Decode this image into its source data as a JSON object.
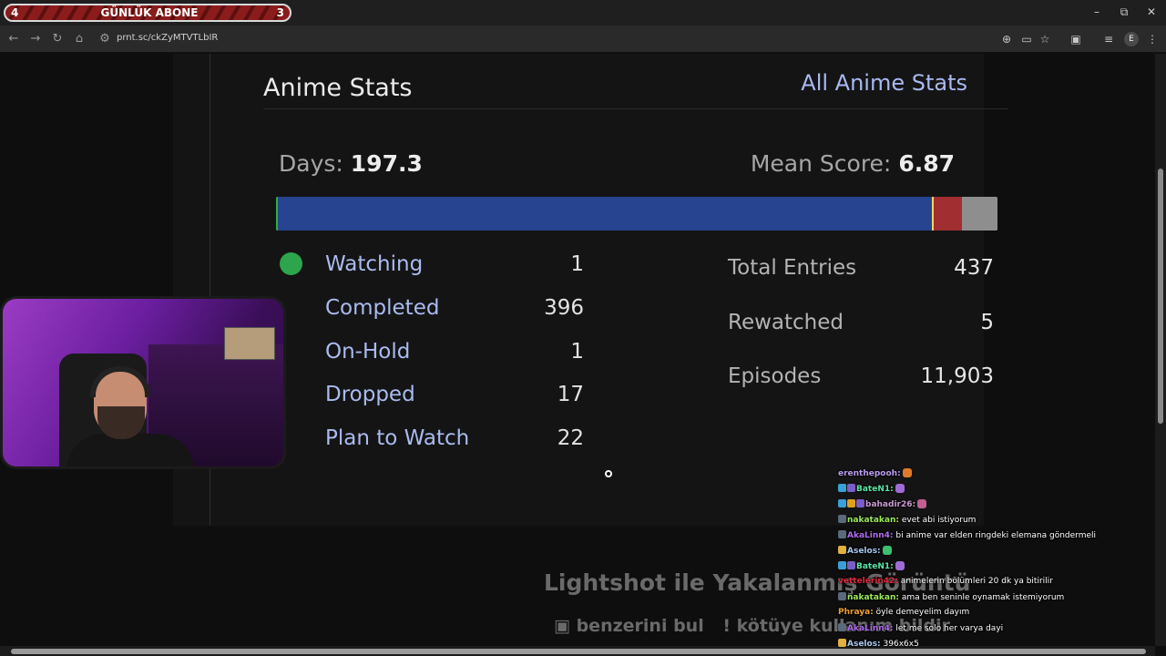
{
  "window": {
    "sub_banner": {
      "left": "4",
      "title": "GÜNLÜK ABONE",
      "right": "3"
    },
    "controls": {
      "minimize": "–",
      "restore": "⧉",
      "close": "✕"
    }
  },
  "browser": {
    "url": "prnt.sc/ckZyMTVTLbIR",
    "profile_initial": "E"
  },
  "stats": {
    "title": "Anime Stats",
    "all_link": "All Anime Stats",
    "days_label": "Days:",
    "days_value": "197.3",
    "mean_label": "Mean Score:",
    "mean_value": "6.87",
    "distribution": [
      {
        "status": "Watching",
        "count": 1,
        "color": "#2db039"
      },
      {
        "status": "Completed",
        "count": 396,
        "color": "#26448f"
      },
      {
        "status": "On-Hold",
        "count": 1,
        "color": "#f9d457"
      },
      {
        "status": "Dropped",
        "count": 17,
        "color": "#a12f31"
      },
      {
        "status": "Plan to Watch",
        "count": 22,
        "color": "#8e8e8e"
      }
    ],
    "list": [
      {
        "label": "Watching",
        "value": "1"
      },
      {
        "label": "Completed",
        "value": "396"
      },
      {
        "label": "On-Hold",
        "value": "1"
      },
      {
        "label": "Dropped",
        "value": "17"
      },
      {
        "label": "Plan to Watch",
        "value": "22"
      }
    ],
    "totals": [
      {
        "label": "Total Entries",
        "value": "437"
      },
      {
        "label": "Rewatched",
        "value": "5"
      },
      {
        "label": "Episodes",
        "value": "11,903"
      }
    ]
  },
  "lightshot": {
    "title": "Lightshot ile Yakalanmış Görüntü",
    "similar": "benzerini bul",
    "report": "kötüye kullanım bildir"
  },
  "chat": [
    {
      "user": "erenthepooh",
      "msg": "",
      "color": "#b99cf0",
      "badges": [],
      "emote": "#e07a2a"
    },
    {
      "user": "BateN1",
      "msg": "",
      "color": "#58e6a4",
      "badges": [
        "#3ba0d8",
        "#7a5ec8"
      ],
      "emote": "#a06bd6"
    },
    {
      "user": "bahadir26",
      "msg": "",
      "color": "#c89ad0",
      "badges": [
        "#3ba0d8",
        "#e0a020",
        "#7a5ec8"
      ],
      "emote": "#c06090"
    },
    {
      "user": "nakatakan",
      "msg": "evet abi istiyorum",
      "color": "#9ae85a",
      "badges": [
        "#5a6a7a"
      ],
      "emote": ""
    },
    {
      "user": "AkaLinn4",
      "msg": "bi anime var elden ringdeki elemana göndermeli",
      "color": "#b06af0",
      "badges": [
        "#5a6a7a"
      ],
      "emote": ""
    },
    {
      "user": "Aselos",
      "msg": "",
      "color": "#a8c8f0",
      "badges": [
        "#e0b040"
      ],
      "emote": "#3ac070"
    },
    {
      "user": "BateN1",
      "msg": "",
      "color": "#58e6a4",
      "badges": [
        "#3ba0d8",
        "#7a5ec8"
      ],
      "emote": "#a06bd6"
    },
    {
      "user": "vettelerin42",
      "msg": "animelerin bölümleri 20 dk ya bitirilir",
      "color": "#e0283c",
      "badges": [],
      "emote": ""
    },
    {
      "user": "nakatakan",
      "msg": "ama ben seninle oynamak istemiyorum",
      "color": "#9ae85a",
      "badges": [
        "#5a6a7a"
      ],
      "emote": ""
    },
    {
      "user": "Phraya",
      "msg": "öyle demeyelim dayım",
      "color": "#f0a030",
      "badges": [],
      "emote": ""
    },
    {
      "user": "AkaLinn4",
      "msg": "let me solo her varya dayi",
      "color": "#b06af0",
      "badges": [
        "#5a6a7a"
      ],
      "emote": ""
    },
    {
      "user": "Aselos",
      "msg": "396x6x5",
      "color": "#a8c8f0",
      "badges": [
        "#e0b040"
      ],
      "emote": ""
    }
  ]
}
